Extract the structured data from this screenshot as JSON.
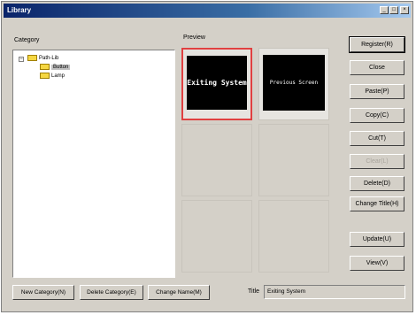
{
  "window": {
    "title": "Library"
  },
  "category": {
    "label": "Category",
    "tree": [
      {
        "label": "Path-Lib"
      },
      {
        "label": "Button"
      },
      {
        "label": "Lamp"
      }
    ]
  },
  "preview": {
    "label": "Preview",
    "tiles": [
      {
        "text": "Exiting System"
      },
      {
        "text": "Previous Screen"
      }
    ]
  },
  "buttons": {
    "register": "Register(R)",
    "close": "Close",
    "paste": "Paste(P)",
    "copy": "Copy(C)",
    "cut": "Cut(T)",
    "disabled": "Clear(L)",
    "delete": "Delete(D)",
    "change_title": "Change Title(H)",
    "update": "Update(U)",
    "view": "View(V)"
  },
  "bottom": {
    "new_category": "New Category(N)",
    "delete_category": "Delete Category(E)",
    "change_name": "Change Name(M)"
  },
  "title_field": {
    "label": "Title",
    "value": "Exiting System"
  },
  "colors": {
    "titlebar": "#0a246a",
    "selection": "#e04040"
  }
}
